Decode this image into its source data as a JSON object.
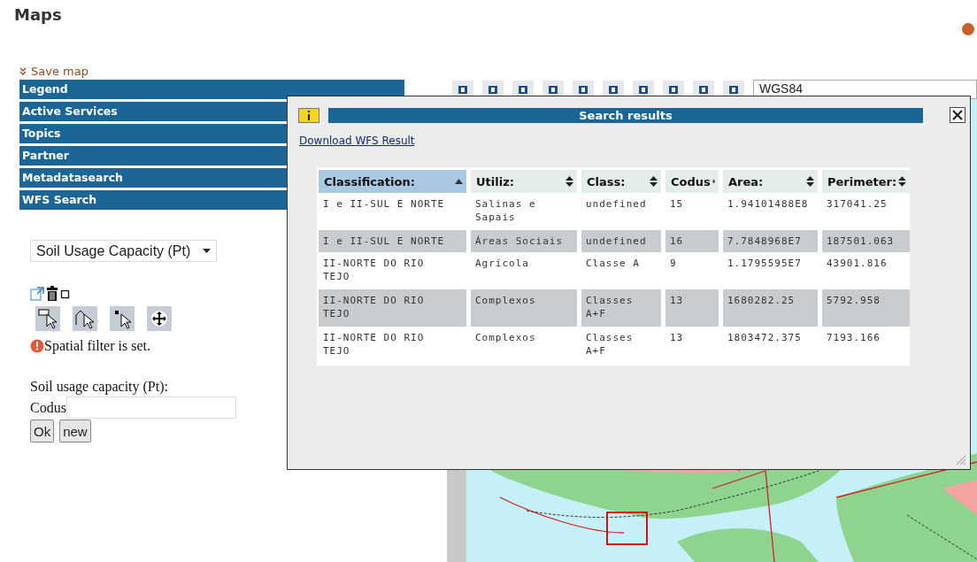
{
  "page": {
    "title": "Maps"
  },
  "save_link": "Save map",
  "accordion": [
    {
      "label": "Legend"
    },
    {
      "label": "Active Services"
    },
    {
      "label": "Topics"
    },
    {
      "label": "Partner"
    },
    {
      "label": "Metadatasearch"
    },
    {
      "label": "WFS Search"
    }
  ],
  "wfs_search": {
    "layer_select": {
      "value": "Soil Usage Capacity (Pt)"
    },
    "filter_message": "Spatial filter is set.",
    "form_title": "Soil usage capacity (Pt):",
    "field_label": "Codus",
    "buttons": [
      "Ok",
      "new"
    ]
  },
  "map_toolbar": {
    "projection": "WGS84"
  },
  "search_results": {
    "title": "Search results",
    "download_link": "Download WFS Result",
    "columns": [
      {
        "label": "Classification:",
        "sorted": true
      },
      {
        "label": "Utiliz:",
        "sorted": false
      },
      {
        "label": "Class:",
        "sorted": false
      },
      {
        "label": "Codus",
        "sorted": false
      },
      {
        "label": "Area:",
        "sorted": false
      },
      {
        "label": "Perimeter:",
        "sorted": false
      }
    ],
    "rows": [
      [
        "I e II-SUL E NORTE",
        "Salinas e Sapais",
        "undefined",
        "15",
        "1.94101488E8",
        "317041.25"
      ],
      [
        "I e II-SUL E NORTE",
        "Áreas Sociais",
        "undefined",
        "16",
        "7.7848968E7",
        "187501.063"
      ],
      [
        "II-NORTE DO RIO TEJO",
        "Agrícola",
        "Classe A",
        "9",
        "1.1795595E7",
        "43901.816"
      ],
      [
        "II-NORTE DO RIO TEJO",
        "Complexos",
        "Classes A+F",
        "13",
        "1680282.25",
        "5792.958"
      ],
      [
        "II-NORTE DO RIO TEJO",
        "Complexos",
        "Classes A+F",
        "13",
        "1803472.375",
        "7193.166"
      ]
    ]
  }
}
